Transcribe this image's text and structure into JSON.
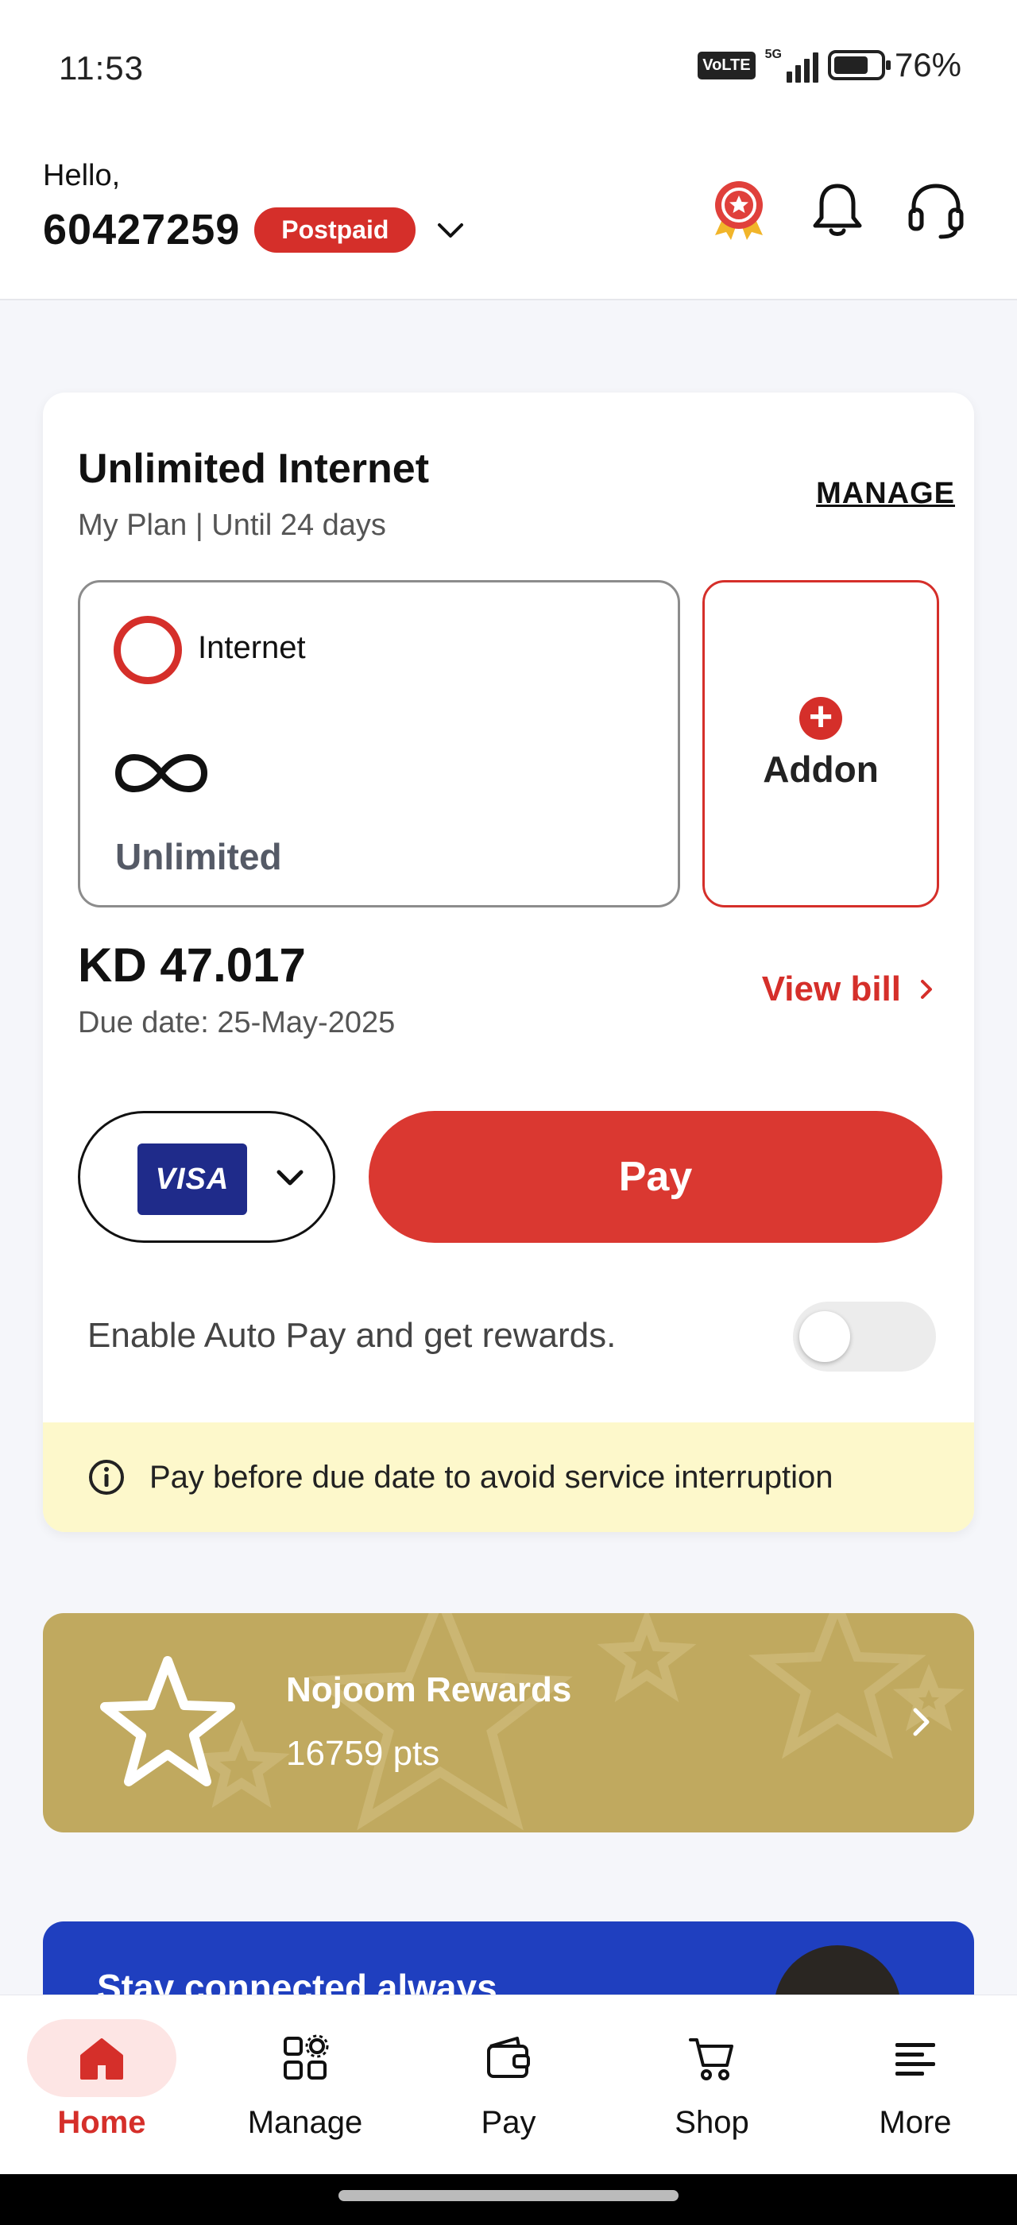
{
  "status_bar": {
    "time": "11:53",
    "volte": "VoLTE",
    "network": "5G",
    "battery_percent": "76%",
    "battery_level": 0.76
  },
  "header": {
    "greeting": "Hello,",
    "number": "60427259",
    "plan_badge": "Postpaid",
    "icons": [
      "rewards-badge-icon",
      "bell-icon",
      "headset-icon"
    ]
  },
  "plan": {
    "title": "Unlimited Internet",
    "subtitle": "My Plan | Until 24 days",
    "manage_label": "MANAGE",
    "internet_label": "Internet",
    "internet_value": "Unlimited",
    "addon_label": "Addon"
  },
  "bill": {
    "amount": "KD 47.017",
    "due_date": "Due date: 25-May-2025",
    "view_bill_label": "View bill",
    "card_brand": "VISA",
    "pay_label": "Pay",
    "autopay_label": "Enable Auto Pay and get rewards.",
    "autopay_enabled": false,
    "warning": "Pay before due date to avoid service interruption"
  },
  "rewards": {
    "title": "Nojoom Rewards",
    "points": "16759 pts"
  },
  "promo": {
    "title": "Stay connected always"
  },
  "bottom_nav": {
    "items": [
      {
        "label": "Home",
        "icon": "home-icon",
        "active": true
      },
      {
        "label": "Manage",
        "icon": "manage-icon",
        "active": false
      },
      {
        "label": "Pay",
        "icon": "wallet-icon",
        "active": false
      },
      {
        "label": "Shop",
        "icon": "cart-icon",
        "active": false
      },
      {
        "label": "More",
        "icon": "menu-icon",
        "active": false
      }
    ]
  },
  "colors": {
    "accent": "#d52f2a",
    "pay_button": "#da3831",
    "rewards_bg": "#c0a95f",
    "promo_bg": "#1f3fbf",
    "warning_bg": "#fdf8cb"
  }
}
